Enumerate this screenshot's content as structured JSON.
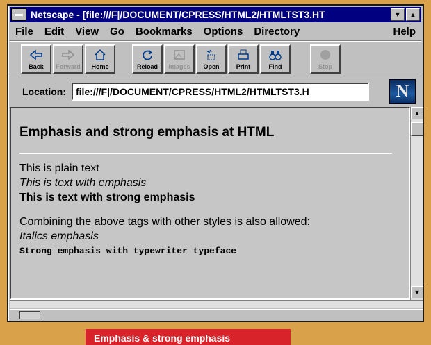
{
  "window": {
    "title": "Netscape - [file:///F|/DOCUMENT/CPRESS/HTML2/HTMLTST3.HT"
  },
  "menu": [
    "File",
    "Edit",
    "View",
    "Go",
    "Bookmarks",
    "Options",
    "Directory",
    "Help"
  ],
  "toolbar": {
    "back": "Back",
    "forward": "Forward",
    "home": "Home",
    "reload": "Reload",
    "images": "Images",
    "open": "Open",
    "print": "Print",
    "find": "Find",
    "stop": "Stop"
  },
  "location": {
    "label": "Location:",
    "value": "file:///F|/DOCUMENT/CPRESS/HTML2/HTMLTST3.H"
  },
  "logo": "N",
  "page": {
    "heading": "Emphasis and strong emphasis at HTML",
    "plain": "This is plain text",
    "emphasis": "This is text with emphasis",
    "strong": "This is text with strong emphasis",
    "combining": "Combining the above tags with other styles is also allowed:",
    "italics_emphasis": "Italics emphasis",
    "typewriter": "Strong emphasis with typewriter typeface"
  },
  "caption": "Emphasis & strong emphasis"
}
